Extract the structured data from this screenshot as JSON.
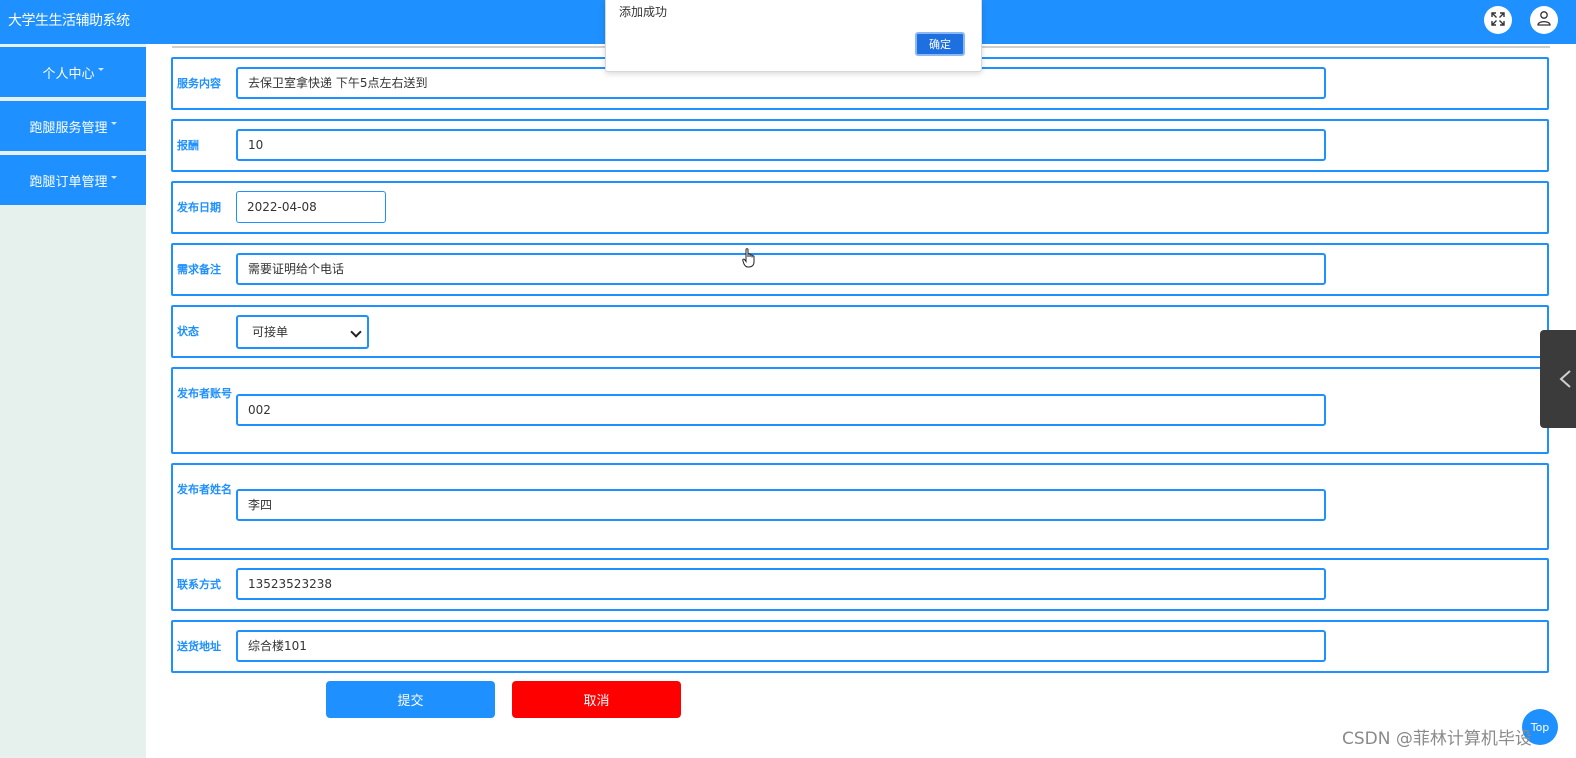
{
  "app": {
    "title": "大学生生活辅助系统"
  },
  "header": {
    "fullscreen_icon": "fullscreen-icon",
    "user_icon": "user-icon"
  },
  "sidebar": {
    "items": [
      {
        "label": "个人中心"
      },
      {
        "label": "跑腿服务管理"
      },
      {
        "label": "跑腿订单管理"
      }
    ]
  },
  "form": {
    "service_content": {
      "label": "服务内容",
      "value": "去保卫室拿快递 下午5点左右送到"
    },
    "reward": {
      "label": "报酬",
      "value": "10"
    },
    "publish_date": {
      "label": "发布日期",
      "value": "2022-04-08"
    },
    "remark": {
      "label": "需求备注",
      "value": "需要证明给个电话"
    },
    "status": {
      "label": "状态",
      "value": "可接单"
    },
    "publisher_account": {
      "label": "发布者账号",
      "value": "002"
    },
    "publisher_name": {
      "label": "发布者姓名",
      "value": "李四"
    },
    "contact": {
      "label": "联系方式",
      "value": "13523523238"
    },
    "address": {
      "label": "送货地址",
      "value": "综合楼101"
    }
  },
  "buttons": {
    "submit": "提交",
    "cancel": "取消"
  },
  "dialog": {
    "message": "添加成功",
    "ok": "确定"
  },
  "floating": {
    "badge": "Top"
  },
  "watermark": "CSDN @菲林计算机毕设",
  "colors": {
    "primary": "#1e90ff",
    "danger": "#ff0000",
    "sidebar_bg": "#e6f0ec"
  }
}
